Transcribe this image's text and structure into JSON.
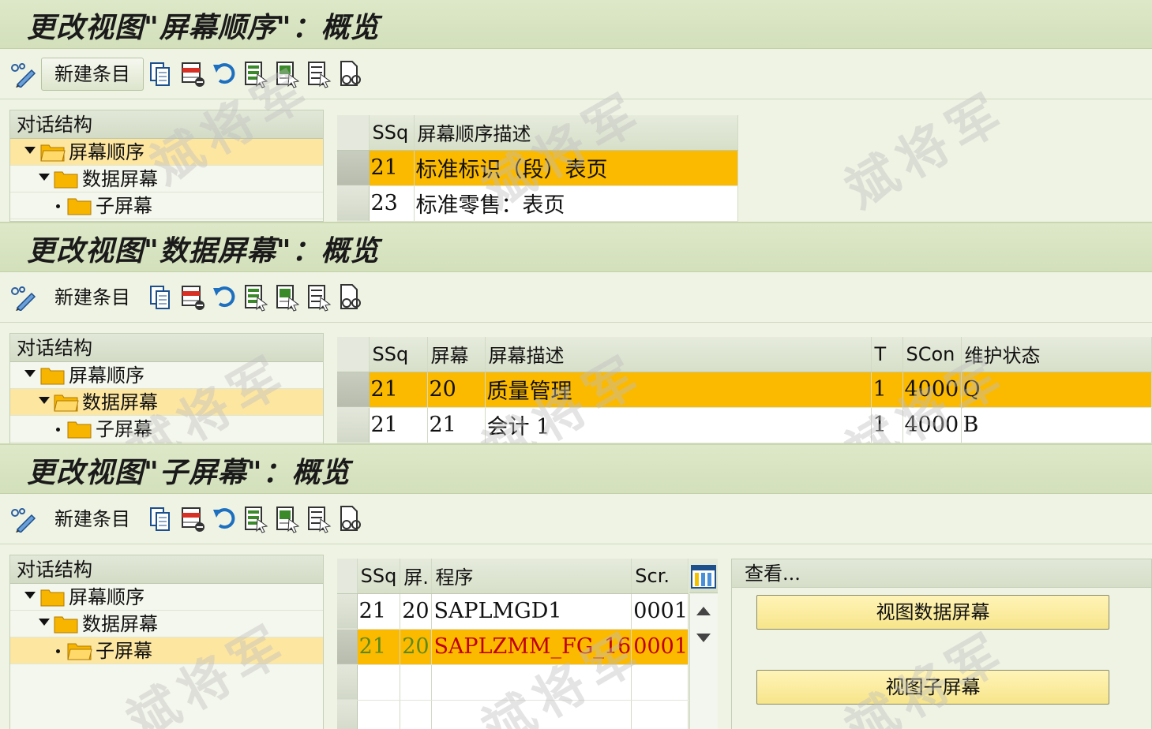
{
  "panels": [
    {
      "title": "更改视图\"屏幕顺序\"：概览",
      "toolbar": {
        "new_entry": "新建条目"
      },
      "tree": {
        "header": "对话结构",
        "items": [
          {
            "label": "屏幕顺序",
            "level": 0,
            "selected": true,
            "open": true
          },
          {
            "label": "数据屏幕",
            "level": 1,
            "selected": false,
            "open": false
          },
          {
            "label": "子屏幕",
            "level": 2,
            "selected": false,
            "open": false
          }
        ]
      },
      "table": {
        "columns": [
          "SSq",
          "屏幕顺序描述"
        ],
        "rows": [
          {
            "cells": [
              "21",
              "标准标识（段）表页"
            ],
            "selected": true
          },
          {
            "cells": [
              "23",
              "标准零售：表页"
            ],
            "selected": false
          }
        ]
      }
    },
    {
      "title": "更改视图\"数据屏幕\"：概览",
      "toolbar": {
        "new_entry": "新建条目"
      },
      "tree": {
        "header": "对话结构",
        "items": [
          {
            "label": "屏幕顺序",
            "level": 0,
            "selected": false,
            "open": false
          },
          {
            "label": "数据屏幕",
            "level": 1,
            "selected": true,
            "open": true
          },
          {
            "label": "子屏幕",
            "level": 2,
            "selected": false,
            "open": false
          }
        ]
      },
      "table": {
        "columns": [
          "SSq",
          "屏幕",
          "屏幕描述",
          "T",
          "SCon",
          "维护状态"
        ],
        "rows": [
          {
            "cells": [
              "21",
              "20",
              "质量管理",
              "1",
              "4000",
              "Q"
            ],
            "selected": true
          },
          {
            "cells": [
              "21",
              "21",
              "会计 1",
              "1",
              "4000",
              "B"
            ],
            "selected": false
          }
        ]
      }
    },
    {
      "title": "更改视图\"子屏幕\"：概览",
      "toolbar": {
        "new_entry": "新建条目"
      },
      "tree": {
        "header": "对话结构",
        "items": [
          {
            "label": "屏幕顺序",
            "level": 0,
            "selected": false,
            "open": false
          },
          {
            "label": "数据屏幕",
            "level": 1,
            "selected": false,
            "open": false
          },
          {
            "label": "子屏幕",
            "level": 2,
            "selected": true,
            "open": true
          }
        ]
      },
      "table": {
        "columns": [
          "SSq",
          "屏.",
          "程序",
          "Scr."
        ],
        "rows": [
          {
            "cells": [
              "21",
              "20",
              "SAPLMGD1",
              "0001"
            ],
            "selected": false
          },
          {
            "cells": [
              "21",
              "20",
              "SAPLZMM_FG_16",
              "0001"
            ],
            "selected": true
          }
        ]
      },
      "view_box": {
        "header": "查看...",
        "buttons": [
          "视图数据屏幕",
          "视图子屏幕"
        ]
      }
    }
  ],
  "watermark": [
    "斌",
    "将",
    "军"
  ],
  "colors": {
    "title_bar": "#d3e0bb",
    "background": "#eef3e4",
    "selected_row": "#fbb900",
    "selected_tree_node": "#fde6a0",
    "folder": "#f7b500",
    "button": "#f7e58a",
    "highlight_text_green": "#5a8a1a",
    "highlight_text_red": "#c00000"
  },
  "icons": [
    "display-change-icon",
    "copy-icon",
    "delete-icon",
    "undo-icon",
    "select-all-icon",
    "select-block-icon",
    "deselect-all-icon",
    "print-preview-icon",
    "column-settings-icon",
    "folder-icon"
  ]
}
